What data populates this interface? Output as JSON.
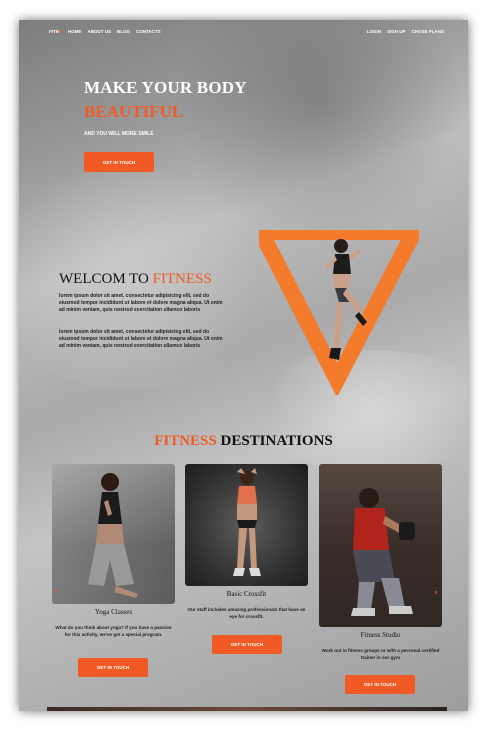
{
  "nav": {
    "logo": "FITN",
    "logo_accent": "E",
    "left_items": [
      "HOME",
      "ABOUT US",
      "BLOG",
      "CONTACTS"
    ],
    "right_items": [
      "LOGIN",
      "SIGN UP",
      "CHOSE PLANS"
    ]
  },
  "hero": {
    "title": "MAKE YOUR BODY",
    "title_accent": "BEAUTIFUL",
    "subtitle": "AND YOU WILL MORE SMILE",
    "button": "GET IN TOUCH"
  },
  "welcome": {
    "title": "WELCOM TO",
    "title_accent": "FITNESS",
    "paragraph1": "lorem ipsum dolor sit amet, consectetur adipisicing elit, sed do eiusmod tempor incididunt ut labore et dolore magna aliqua. Ut enim ad minim veniam, quis nostrud exercitation ullamco laboris",
    "paragraph2": "lorem ipsum dolor sit amet, consectetur adipisicing elit, sed do eiusmod tempor incididunt ut labore et dolore magna aliqua. Ut enim ad minim veniam, quis nostrud exercitation ullamco laboris"
  },
  "destinations": {
    "title_accent": "FITNESS",
    "title": "DESTINATIONS",
    "cards": [
      {
        "title": "Yoga Classes",
        "desc": "What do you think about yoga? If you have a passion for this activity, we've got a special program.",
        "button": "GET IN TOUCH"
      },
      {
        "title": "Basic Crossfit",
        "desc": "Our staff includes amazing professionals that have an eye for crossfit.",
        "button": "GET IN TOUCH"
      },
      {
        "title": "Fitness Studio",
        "desc": "Work out in fitness groups or with a personal certified trainer in our gym",
        "button": "GET IN TOUCH"
      }
    ]
  },
  "colors": {
    "accent": "#f15a24",
    "heading": "#111111"
  },
  "icons": {
    "prev": "chevron-left-icon",
    "next": "chevron-right-icon"
  }
}
